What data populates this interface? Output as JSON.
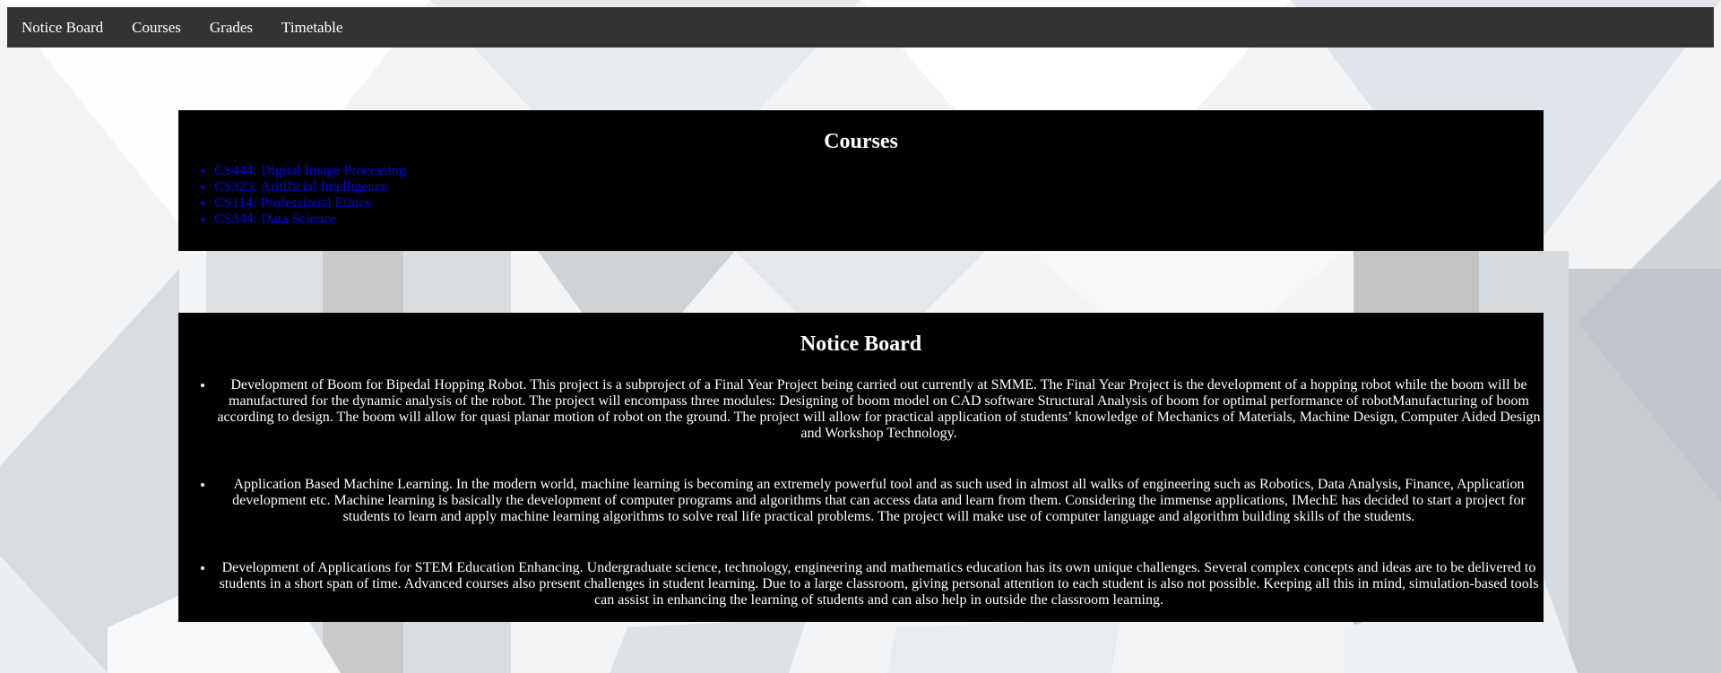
{
  "nav": {
    "items": [
      {
        "label": "Notice Board"
      },
      {
        "label": "Courses"
      },
      {
        "label": "Grades"
      },
      {
        "label": "Timetable"
      }
    ]
  },
  "courses": {
    "title": "Courses",
    "items": [
      {
        "label": "CS444: Digital Image Processing"
      },
      {
        "label": "CS323: Aritificial Intelligence"
      },
      {
        "label": "CS114: Professional Ethics"
      },
      {
        "label": "CS344: Data Science"
      }
    ]
  },
  "notice_board": {
    "title": "Notice Board",
    "items": [
      {
        "text": "Development of Boom for Bipedal Hopping Robot. This project is a subproject of a Final Year Project being carried out currently at SMME. The Final Year Project is the development of a hopping robot while the boom will be manufactured for the dynamic analysis of the robot. The project will encompass three modules: Designing of boom model on CAD software Structural Analysis of boom for optimal performance of robotManufacturing of boom according to design. The boom will allow for quasi planar motion of robot on the ground. The project will allow for practical application of students’ knowledge of Mechanics of Materials, Machine Design, Computer Aided Design and Workshop Technology."
      },
      {
        "text": "Application Based Machine Learning. In the modern world, machine learning is becoming an extremely powerful tool and as such used in almost all walks of engineering such as Robotics, Data Analysis, Finance, Application development etc. Machine learning is basically the development of computer programs and algorithms that can access data and learn from them. Considering the immense applications, IMechE has decided to start a project for students to learn and apply machine learning algorithms to solve real life practical problems. The project will make use of computer language and algorithm building skills of the students."
      },
      {
        "text": "Development of Applications for STEM Education Enhancing. Undergraduate science, technology, engineering and mathematics education has its own unique challenges. Several complex concepts and ideas are to be delivered to students in a short span of time. Advanced courses also present challenges in student learning. Due to a large classroom, giving personal attention to each student is also not possible. Keeping all this in mind, simulation-based tools can assist in enhancing the learning of students and can also help in outside the classroom learning."
      }
    ]
  },
  "colors": {
    "navbar": "#333333",
    "panel": "#000000",
    "link": "#0000ee",
    "text": "#ffffff"
  }
}
